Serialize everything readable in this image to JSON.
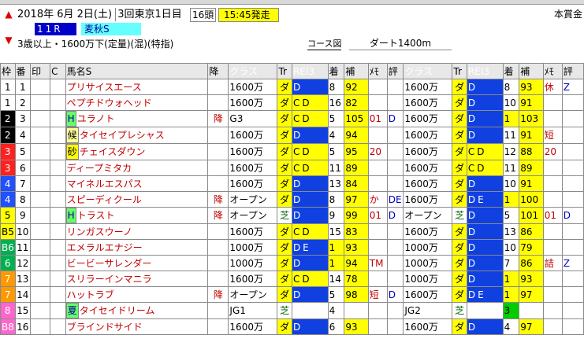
{
  "header": {
    "date_year": "2018年",
    "date_md": "6月 2日(土)",
    "meet": "3回東京1日目",
    "field": "16頭",
    "time": "15:45発走",
    "prize_label": "本賞金",
    "race_no": "11R",
    "race_name": "麦秋S",
    "conditions": "3歳以上・1600万下(定量)(混)(特指)",
    "course_link": "コース図",
    "course": "ダート1400m"
  },
  "columns": [
    "枠",
    "番",
    "印",
    "C",
    "馬名S",
    "降",
    "クラス",
    "Tr",
    "REI3",
    "着",
    "補",
    "ﾒﾓ",
    "評",
    "クラス",
    "Tr",
    "REI3",
    "着",
    "補",
    "ﾒﾓ",
    "評"
  ],
  "rows": [
    {
      "waku": "1",
      "ban": "1",
      "mark": "",
      "name": "プリサイスエース",
      "kou": "",
      "c1": "1600万",
      "t1": "ダ",
      "r1": "D",
      "k1": "8",
      "h1": "92",
      "m1": "",
      "e1": "",
      "c2": "1600万",
      "t2": "ダ",
      "r2": "D",
      "k2": "8",
      "h2": "93",
      "m2": "休",
      "e2": "Z"
    },
    {
      "waku": "1",
      "ban": "2",
      "mark": "",
      "name": "ペプチドウォヘッド",
      "kou": "",
      "c1": "1600万",
      "t1": "ダ",
      "r1": "CD",
      "k1": "16",
      "h1": "82",
      "m1": "",
      "e1": "",
      "c2": "1600万",
      "t2": "ダ",
      "r2": "D",
      "k2": "10",
      "h2": "91",
      "m2": "",
      "e2": ""
    },
    {
      "waku": "2",
      "ban": "3",
      "mark": "H",
      "name": "ユラノト",
      "kou": "降",
      "c1": "G3",
      "t1": "ダ",
      "r1": "CD",
      "k1": "5",
      "h1": "105",
      "m1": "01",
      "e1": "D",
      "c2": "1600万",
      "t2": "ダ",
      "r2": "D",
      "k2": "1",
      "h2": "103",
      "m2": "",
      "e2": ""
    },
    {
      "waku": "2",
      "ban": "4",
      "mark": "候",
      "name": "タイセイプレシャス",
      "kou": "",
      "c1": "1600万",
      "t1": "ダ",
      "r1": "D",
      "k1": "4",
      "h1": "94",
      "m1": "",
      "e1": "",
      "c2": "1600万",
      "t2": "ダ",
      "r2": "D",
      "k2": "11",
      "h2": "91",
      "m2": "短",
      "e2": ""
    },
    {
      "waku": "3",
      "ban": "5",
      "mark": "砂",
      "name": "チェイスダウン",
      "kou": "",
      "c1": "1600万",
      "t1": "ダ",
      "r1": "CD",
      "k1": "5",
      "h1": "95",
      "m1": "20",
      "e1": "",
      "c2": "1600万",
      "t2": "ダ",
      "r2": "CD",
      "k2": "12",
      "h2": "88",
      "m2": "20",
      "e2": ""
    },
    {
      "waku": "3",
      "ban": "6",
      "mark": "",
      "name": "ディープミタカ",
      "kou": "",
      "c1": "1600万",
      "t1": "ダ",
      "r1": "CD",
      "k1": "11",
      "h1": "89",
      "m1": "",
      "e1": "",
      "c2": "1600万",
      "t2": "ダ",
      "r2": "CD",
      "k2": "11",
      "h2": "89",
      "m2": "",
      "e2": ""
    },
    {
      "waku": "4",
      "ban": "7",
      "mark": "",
      "name": "マイネルエスパス",
      "kou": "",
      "c1": "1600万",
      "t1": "ダ",
      "r1": "D",
      "k1": "13",
      "h1": "84",
      "m1": "",
      "e1": "",
      "c2": "1600万",
      "t2": "ダ",
      "r2": "D",
      "k2": "10",
      "h2": "91",
      "m2": "",
      "e2": ""
    },
    {
      "waku": "4",
      "ban": "8",
      "mark": "",
      "name": "スピーディクール",
      "kou": "降",
      "c1": "オープン",
      "t1": "ダ",
      "r1": "D",
      "k1": "8",
      "h1": "97",
      "m1": "か",
      "e1": "DE",
      "c2": "1600万",
      "t2": "ダ",
      "r2": "DE",
      "k2": "1",
      "h2": "100",
      "m2": "",
      "e2": ""
    },
    {
      "waku": "5",
      "ban": "9",
      "mark": "H",
      "name": "トラスト",
      "kou": "降",
      "c1": "オープン",
      "t1": "芝",
      "r1": "D",
      "k1": "9",
      "h1": "99",
      "m1": "01",
      "e1": "D",
      "c2": "オープン",
      "t2": "芝",
      "r2": "D",
      "k2": "5",
      "h2": "101",
      "m2": "01",
      "e2": "D"
    },
    {
      "waku": "B5",
      "ban": "10",
      "mark": "",
      "name": "リンガスウーノ",
      "kou": "",
      "c1": "1600万",
      "t1": "ダ",
      "r1": "CD",
      "k1": "15",
      "h1": "83",
      "m1": "",
      "e1": "",
      "c2": "1600万",
      "t2": "ダ",
      "r2": "D",
      "k2": "13",
      "h2": "86",
      "m2": "",
      "e2": ""
    },
    {
      "waku": "B6",
      "ban": "11",
      "mark": "",
      "name": "エメラルエナジー",
      "kou": "",
      "c1": "1000万",
      "t1": "ダ",
      "r1": "DE",
      "k1": "1",
      "h1": "93",
      "m1": "",
      "e1": "",
      "c2": "1000万",
      "t2": "ダ",
      "r2": "D",
      "k2": "10",
      "h2": "79",
      "m2": "",
      "e2": ""
    },
    {
      "waku": "6",
      "ban": "12",
      "mark": "",
      "name": "ビービーサレンダー",
      "kou": "",
      "c1": "1000万",
      "t1": "ダ",
      "r1": "D",
      "k1": "1",
      "h1": "94",
      "m1": "TM",
      "e1": "",
      "c2": "1000万",
      "t2": "ダ",
      "r2": "D",
      "k2": "7",
      "h2": "86",
      "m2": "詰",
      "e2": "Z"
    },
    {
      "waku": "7",
      "ban": "13",
      "mark": "",
      "name": "スリラーインマニラ",
      "kou": "",
      "c1": "1600万",
      "t1": "ダ",
      "r1": "CD",
      "k1": "14",
      "h1": "78",
      "m1": "",
      "e1": "",
      "c2": "1000万",
      "t2": "ダ",
      "r2": "D",
      "k2": "1",
      "h2": "93",
      "m2": "",
      "e2": ""
    },
    {
      "waku": "7",
      "ban": "14",
      "mark": "",
      "name": "ハットラブ",
      "kou": "降",
      "c1": "オープン",
      "t1": "ダ",
      "r1": "D",
      "k1": "5",
      "h1": "98",
      "m1": "短",
      "e1": "D",
      "c2": "1600万",
      "t2": "ダ",
      "r2": "DE",
      "k2": "1",
      "h2": "97",
      "m2": "",
      "e2": ""
    },
    {
      "waku": "8",
      "ban": "15",
      "mark": "夏",
      "name": "タイセイドリーム",
      "kou": "",
      "c1": "JG1",
      "t1": "芝",
      "r1": "",
      "k1": "4",
      "h1": "",
      "m1": "",
      "e1": "",
      "c2": "JG2",
      "t2": "芝",
      "r2": "",
      "k2": "3",
      "h2": "",
      "m2": "",
      "e2": ""
    },
    {
      "waku": "B8",
      "ban": "16",
      "mark": "",
      "name": "ブラインドサイド",
      "kou": "",
      "c1": "1600万",
      "t1": "ダ",
      "r1": "D",
      "k1": "6",
      "h1": "93",
      "m1": "",
      "e1": "",
      "c2": "1600万",
      "t2": "ダ",
      "r2": "D",
      "k2": "4",
      "h2": "97",
      "m2": "",
      "e2": ""
    }
  ]
}
